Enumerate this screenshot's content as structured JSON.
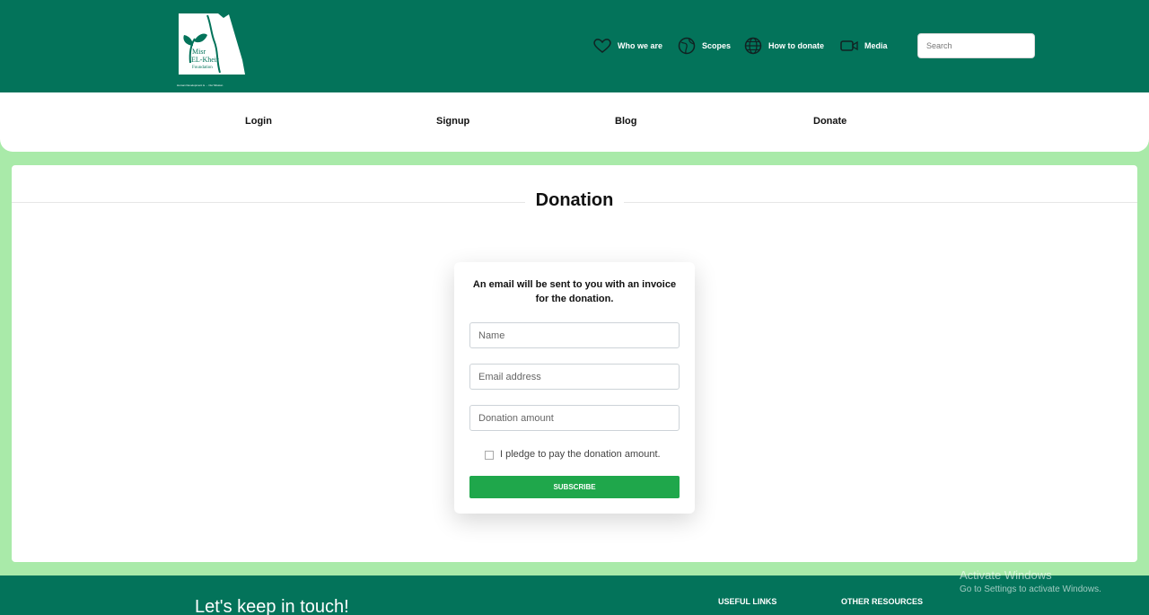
{
  "header": {
    "logo_text": "Misr EL-Kheir Foundation",
    "logo_tagline": "Human Development is ... Our Mission",
    "nav": [
      {
        "label": "Who we are",
        "icon": "heart-icon"
      },
      {
        "label": "Scopes",
        "icon": "globe-icon"
      },
      {
        "label": "How to donate",
        "icon": "world-grid-icon"
      },
      {
        "label": "Media",
        "icon": "video-camera-icon"
      }
    ],
    "search_placeholder": "Search"
  },
  "subnav": [
    "Login",
    "Signup",
    "Blog",
    "Donate"
  ],
  "page": {
    "title": "Donation",
    "note": "An email will be sent to you with an invoice for the donation.",
    "fields": {
      "name_placeholder": "Name",
      "email_placeholder": "Email address",
      "amount_placeholder": "Donation amount"
    },
    "pledge_label": "I pledge to pay the donation amount.",
    "submit_label": "SUBSCRIBE"
  },
  "footer": {
    "heading": "Let's keep in touch!",
    "useful_links": "USEFUL LINKS",
    "other_resources": "OTHER RESOURCES"
  },
  "watermark": {
    "title": "Activate Windows",
    "subtitle": "Go to Settings to activate Windows."
  },
  "colors": {
    "brand_green": "#03735a",
    "page_green": "#a9eaa9",
    "button_green": "#1fa74b"
  }
}
